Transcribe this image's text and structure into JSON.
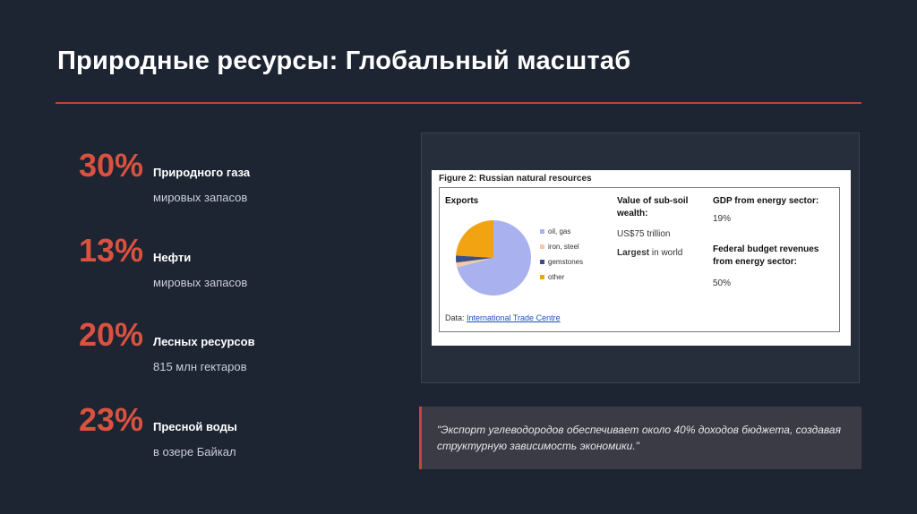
{
  "title": "Природные ресурсы: Глобальный масштаб",
  "stats": [
    {
      "value": "30%",
      "label": "Природного газа",
      "sub": "мировых запасов"
    },
    {
      "value": "13%",
      "label": "Нефти",
      "sub": "мировых запасов"
    },
    {
      "value": "20%",
      "label": "Лесных ресурсов",
      "sub": "815 млн гектаров"
    },
    {
      "value": "23%",
      "label": "Пресной воды",
      "sub": "в озере Байкал"
    }
  ],
  "figure": {
    "title": "Figure 2: Russian natural resources",
    "exports_heading": "Exports",
    "value_heading": "Value of sub-soil wealth:",
    "value": "US$75 trillion",
    "largest_bold": "Largest",
    "largest_rest": " in world",
    "gdp_heading": "GDP from energy sector:",
    "gdp_value": "19%",
    "budget_heading": "Federal budget revenues from energy sector:",
    "budget_value": "50%",
    "data_label": "Data: ",
    "data_source": "International Trade Centre",
    "colors": {
      "oil_gas": "#a9b1ee",
      "iron_steel": "#f5c8a8",
      "gemstones": "#3b4f86",
      "other": "#f2a312"
    }
  },
  "chart_data": {
    "type": "pie",
    "categories": [
      "oil, gas",
      "iron, steel",
      "gemstones",
      "other"
    ],
    "values": [
      71,
      2,
      3,
      24
    ]
  },
  "quote": "\"Экспорт углеводородов обеспечивает около 40% доходов бюджета, создавая структурную зависимость экономики.\""
}
